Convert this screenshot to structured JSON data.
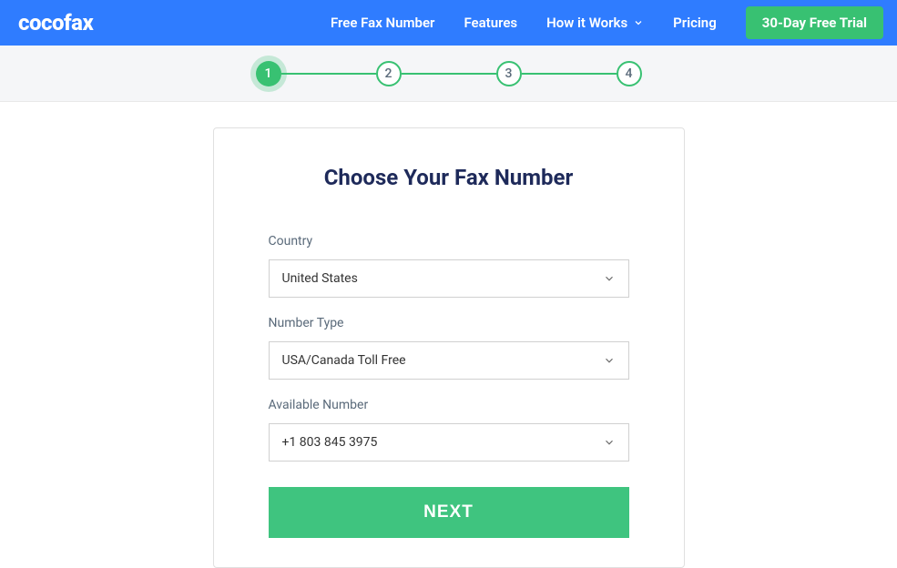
{
  "brand": "cocofax",
  "nav": {
    "links": [
      "Free Fax Number",
      "Features",
      "How it Works",
      "Pricing"
    ],
    "cta": "30-Day Free Trial"
  },
  "stepper": {
    "steps": [
      "1",
      "2",
      "3",
      "4"
    ],
    "current": 1
  },
  "form": {
    "title": "Choose Your Fax Number",
    "fields": {
      "country": {
        "label": "Country",
        "value": "United States"
      },
      "number_type": {
        "label": "Number Type",
        "value": "USA/Canada Toll Free"
      },
      "available_number": {
        "label": "Available Number",
        "value": "+1 803 845 3975"
      }
    },
    "next": "NEXT"
  }
}
